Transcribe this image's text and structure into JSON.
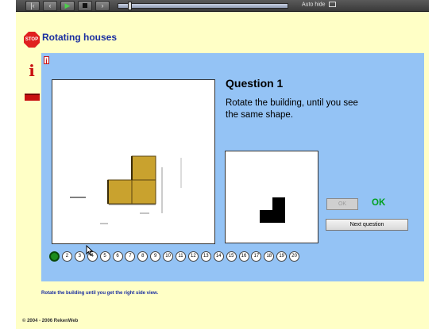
{
  "toolbar": {
    "buttons": [
      {
        "name": "rewind-start-button",
        "glyph": "|<"
      },
      {
        "name": "back-button",
        "glyph": "<"
      },
      {
        "name": "play-button",
        "glyph": "▶"
      },
      {
        "name": "stop-button",
        "glyph": ""
      },
      {
        "name": "forward-button",
        "glyph": ">"
      },
      {
        "name": "forward-end-button",
        "glyph": ">|"
      }
    ],
    "progress": 0.06,
    "autohide_label": "Auto hide"
  },
  "app": {
    "title": "Rotating houses",
    "stop_icon_text": "STOP",
    "info_icon_glyph": "i"
  },
  "question": {
    "title": "Question 1",
    "text": "Rotate the building, until you see the same shape."
  },
  "buttons": {
    "ok_label": "OK",
    "ok_status": "OK",
    "next_label": "Next question"
  },
  "question_nav": {
    "current": 1,
    "items": [
      "1",
      "2",
      "3",
      "4",
      "5",
      "6",
      "7",
      "8",
      "9",
      "10",
      "11",
      "12",
      "13",
      "14",
      "15",
      "16",
      "17",
      "18",
      "19",
      "20"
    ]
  },
  "footer": {
    "instruction": "Rotate the building until you get the right side view.",
    "copyright": "© 2004 - 2006 RekenWeb"
  },
  "colors": {
    "page_bg": "#ffffc6",
    "panel_bg": "#94c3f5",
    "title": "#1a2ea0",
    "block": "#c9a22e",
    "ok_green": "#00a020"
  },
  "icons": [
    "stop-icon",
    "info-icon",
    "toolbar-bar-icon",
    "small-info-icon",
    "mouse-cursor-icon"
  ]
}
